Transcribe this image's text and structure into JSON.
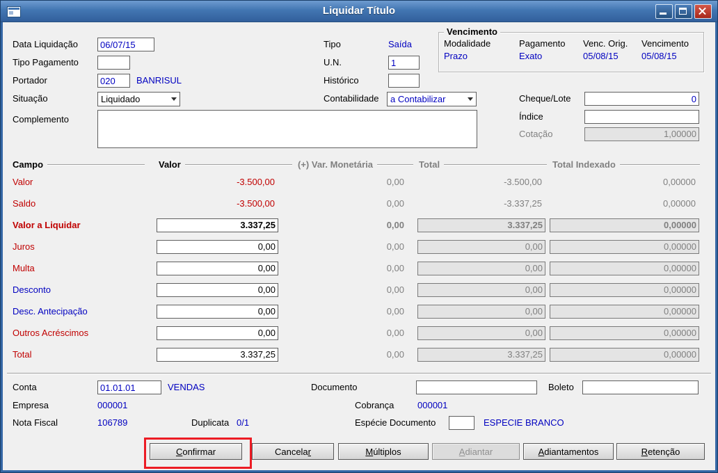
{
  "window": {
    "title": "Liquidar Título"
  },
  "colors": {
    "titlebar_blue": "#3a6fae",
    "value_blue": "#0000c0",
    "negative_red": "#c00000",
    "disabled_gray": "#808080",
    "highlight_red": "#ec1c24"
  },
  "top_left": {
    "data_liquidacao_label": "Data Liquidação",
    "data_liquidacao_value": "06/07/15",
    "tipo_pagamento_label": "Tipo Pagamento",
    "tipo_pagamento_value": "",
    "portador_label": "Portador",
    "portador_value": "020",
    "portador_name": "BANRISUL",
    "situacao_label": "Situação",
    "situacao_value": "Liquidado",
    "complemento_label": "Complemento",
    "complemento_value": ""
  },
  "top_mid": {
    "tipo_label": "Tipo",
    "tipo_value": "Saída",
    "un_label": "U.N.",
    "un_value": "1",
    "historico_label": "Histórico",
    "historico_value": "",
    "contabilidade_label": "Contabilidade",
    "contabilidade_value": "a Contabilizar"
  },
  "vencimento": {
    "caption": "Vencimento",
    "columns": [
      {
        "label": "Modalidade",
        "value": "Prazo"
      },
      {
        "label": "Pagamento",
        "value": "Exato"
      },
      {
        "label": "Venc. Orig.",
        "value": "05/08/15"
      },
      {
        "label": "Vencimento",
        "value": "05/08/15"
      }
    ]
  },
  "top_right": {
    "cheque_lote_label": "Cheque/Lote",
    "cheque_lote_value": "0",
    "indice_label": "Índice",
    "indice_value": "",
    "cotacao_label": "Cotação",
    "cotacao_value": "1,00000"
  },
  "grid": {
    "headers": [
      {
        "label": "Campo",
        "muted": false
      },
      {
        "label": "Valor",
        "muted": false
      },
      {
        "label": "(+) Var. Monetária",
        "muted": true
      },
      {
        "label": "Total",
        "muted": true
      },
      {
        "label": "Total Indexado",
        "muted": true
      }
    ],
    "rows": [
      {
        "label": "Valor",
        "label_color": "red",
        "bold": false,
        "boxed": false,
        "valor": "-3.500,00",
        "valor_red": true,
        "var_monetaria": "0,00",
        "total": "-3.500,00",
        "total_indexado": "0,00000"
      },
      {
        "label": "Saldo",
        "label_color": "red",
        "bold": false,
        "boxed": false,
        "valor": "-3.500,00",
        "valor_red": true,
        "var_monetaria": "0,00",
        "total": "-3.337,25",
        "total_indexado": "0,00000"
      },
      {
        "label": "Valor a Liquidar",
        "label_color": "red",
        "bold": true,
        "boxed": true,
        "valor": "3.337,25",
        "valor_red": false,
        "var_monetaria": "0,00",
        "total": "3.337,25",
        "total_indexado": "0,00000"
      },
      {
        "label": "Juros",
        "label_color": "red",
        "bold": false,
        "boxed": true,
        "valor": "0,00",
        "valor_red": false,
        "var_monetaria": "0,00",
        "total": "0,00",
        "total_indexado": "0,00000"
      },
      {
        "label": "Multa",
        "label_color": "red",
        "bold": false,
        "boxed": true,
        "valor": "0,00",
        "valor_red": false,
        "var_monetaria": "0,00",
        "total": "0,00",
        "total_indexado": "0,00000"
      },
      {
        "label": "Desconto",
        "label_color": "blue",
        "bold": false,
        "boxed": true,
        "valor": "0,00",
        "valor_red": false,
        "var_monetaria": "0,00",
        "total": "0,00",
        "total_indexado": "0,00000"
      },
      {
        "label": "Desc. Antecipação",
        "label_color": "blue",
        "bold": false,
        "boxed": true,
        "valor": "0,00",
        "valor_red": false,
        "var_monetaria": "0,00",
        "total": "0,00",
        "total_indexado": "0,00000"
      },
      {
        "label": "Outros Acréscimos",
        "label_color": "red",
        "bold": false,
        "boxed": true,
        "valor": "0,00",
        "valor_red": false,
        "var_monetaria": "0,00",
        "total": "0,00",
        "total_indexado": "0,00000"
      },
      {
        "label": "Total",
        "label_color": "red",
        "bold": false,
        "boxed": true,
        "valor": "3.337,25",
        "valor_red": false,
        "var_monetaria": "0,00",
        "total": "3.337,25",
        "total_indexado": "0,00000"
      }
    ]
  },
  "bottom": {
    "conta_label": "Conta",
    "conta_value": "01.01.01",
    "conta_name": "VENDAS",
    "documento_label": "Documento",
    "documento_value": "",
    "boleto_label": "Boleto",
    "boleto_value": "",
    "empresa_label": "Empresa",
    "empresa_value": "000001",
    "cobranca_label": "Cobrança",
    "cobranca_value": "000001",
    "nota_fiscal_label": "Nota Fiscal",
    "nota_fiscal_value": "106789",
    "duplicata_label": "Duplicata",
    "duplicata_value": "0/1",
    "especie_label": "Espécie Documento",
    "especie_value": "",
    "especie_name": "ESPECIE BRANCO"
  },
  "buttons": [
    {
      "label": "Confirmar",
      "mnemonic_index": 0,
      "enabled": true,
      "highlighted": true
    },
    {
      "label": "Cancelar",
      "mnemonic_index": 7,
      "enabled": true,
      "highlighted": false
    },
    {
      "label": "Múltiplos",
      "mnemonic_index": 0,
      "enabled": true,
      "highlighted": false
    },
    {
      "label": "Adiantar",
      "mnemonic_index": 0,
      "enabled": false,
      "highlighted": false
    },
    {
      "label": "Adiantamentos",
      "mnemonic_index": 0,
      "enabled": true,
      "highlighted": false
    },
    {
      "label": "Retenção",
      "mnemonic_index": 0,
      "enabled": true,
      "highlighted": false
    }
  ]
}
